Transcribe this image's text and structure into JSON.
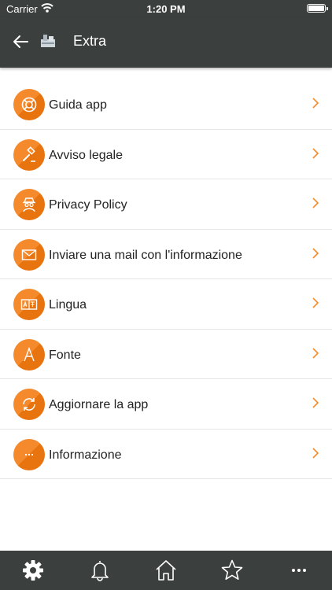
{
  "status_bar": {
    "carrier": "Carrier",
    "time": "1:20 PM"
  },
  "nav": {
    "title": "Extra"
  },
  "menu": {
    "items": [
      {
        "label": "Guida app",
        "icon": "lifebuoy-icon"
      },
      {
        "label": "Avviso legale",
        "icon": "gavel-icon"
      },
      {
        "label": "Privacy Policy",
        "icon": "detective-icon"
      },
      {
        "label": "Inviare una mail con l'informazione",
        "icon": "mail-icon"
      },
      {
        "label": "Lingua",
        "icon": "translate-icon"
      },
      {
        "label": "Fonte",
        "icon": "font-icon"
      },
      {
        "label": "Aggiornare la app",
        "icon": "refresh-icon"
      },
      {
        "label": "Informazione",
        "icon": "more-dots-icon"
      }
    ]
  },
  "tabs": [
    "gear-icon",
    "bell-icon",
    "home-icon",
    "star-icon",
    "more-icon"
  ],
  "colors": {
    "bar": "#3b3f3d",
    "accent": "#f58a2c",
    "chevron": "#f58a2c"
  }
}
